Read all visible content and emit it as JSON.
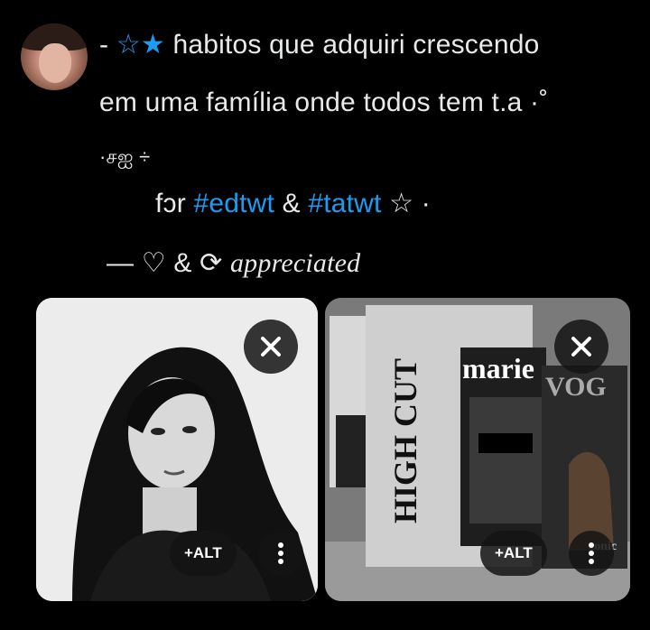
{
  "tweet": {
    "line1_prefix": "- ",
    "line1_deco": "☆★ ",
    "line1_text": "ɦabitos que adquiri crescendo",
    "line2_text": "em uma família onde todos tem t.a",
    "line2_deco": " ·˚",
    "line3_text": "·சஐ ÷",
    "line4_for": "fɔr ",
    "hashtag1": "#edtwt",
    "amp": " & ",
    "hashtag2": "#tatwt",
    "line4_deco": " ☆ ·",
    "line5_prefix": "— ♡ & ⟳ ",
    "line5_italic": "appreciated"
  },
  "attachments": [
    {
      "alt_label": "+ALT",
      "close_icon": "close-icon",
      "more_icon": "more-vertical-icon"
    },
    {
      "alt_label": "+ALT",
      "close_icon": "close-icon",
      "more_icon": "more-vertical-icon",
      "magazine_text": {
        "marie": "marie",
        "vogue": "VOG",
        "highcut": "HIGH CUT",
        "iconic": "conic"
      }
    }
  ]
}
